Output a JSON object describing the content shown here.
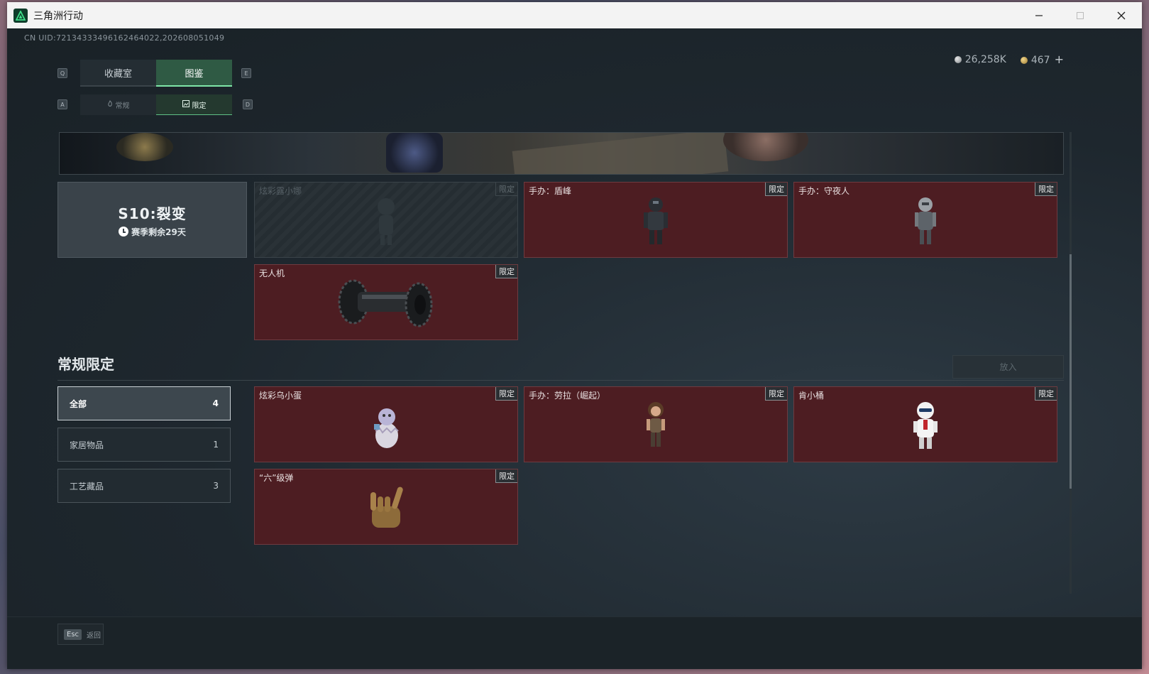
{
  "window": {
    "title": "三角洲行动"
  },
  "header": {
    "uid": "CN UID:7213433349616246402​2,202608051049",
    "currency_silver": "26,258K",
    "currency_gold": "467",
    "plus": "+"
  },
  "keys": {
    "prev_tab": "Q",
    "next_tab": "E",
    "prev_sub": "A",
    "next_sub": "D"
  },
  "tabs": [
    {
      "label": "收藏室"
    },
    {
      "label": "图鉴"
    }
  ],
  "subtabs": [
    {
      "label": "常规"
    },
    {
      "label": "限定"
    }
  ],
  "season": {
    "title": "S10:裂变",
    "remaining": "赛季剩余29天"
  },
  "season_items": [
    {
      "name": "炫彩露小娜",
      "tag": "限定"
    },
    {
      "name": "手办：盾峰",
      "tag": "限定"
    },
    {
      "name": "手办：守夜人",
      "tag": "限定"
    },
    {
      "name": "无人机",
      "tag": "限定"
    }
  ],
  "section": {
    "title": "常规限定",
    "put_button": "放入"
  },
  "filters": [
    {
      "label": "全部",
      "count": "4"
    },
    {
      "label": "家居物品",
      "count": "1"
    },
    {
      "label": "工艺藏品",
      "count": "3"
    }
  ],
  "regular_items": [
    {
      "name": "炫彩乌小蛋",
      "tag": "限定"
    },
    {
      "name": "手办：劳拉（崛起）",
      "tag": "限定"
    },
    {
      "name": "肯小桶",
      "tag": "限定"
    },
    {
      "name": "“六”级弹",
      "tag": "限定"
    }
  ],
  "footer": {
    "esc_key": "Esc",
    "back_label": "返回"
  },
  "colors": {
    "accent": "#7fe6a8",
    "card_bg": "#4d1d22",
    "panel_bg": "#1f272d"
  }
}
